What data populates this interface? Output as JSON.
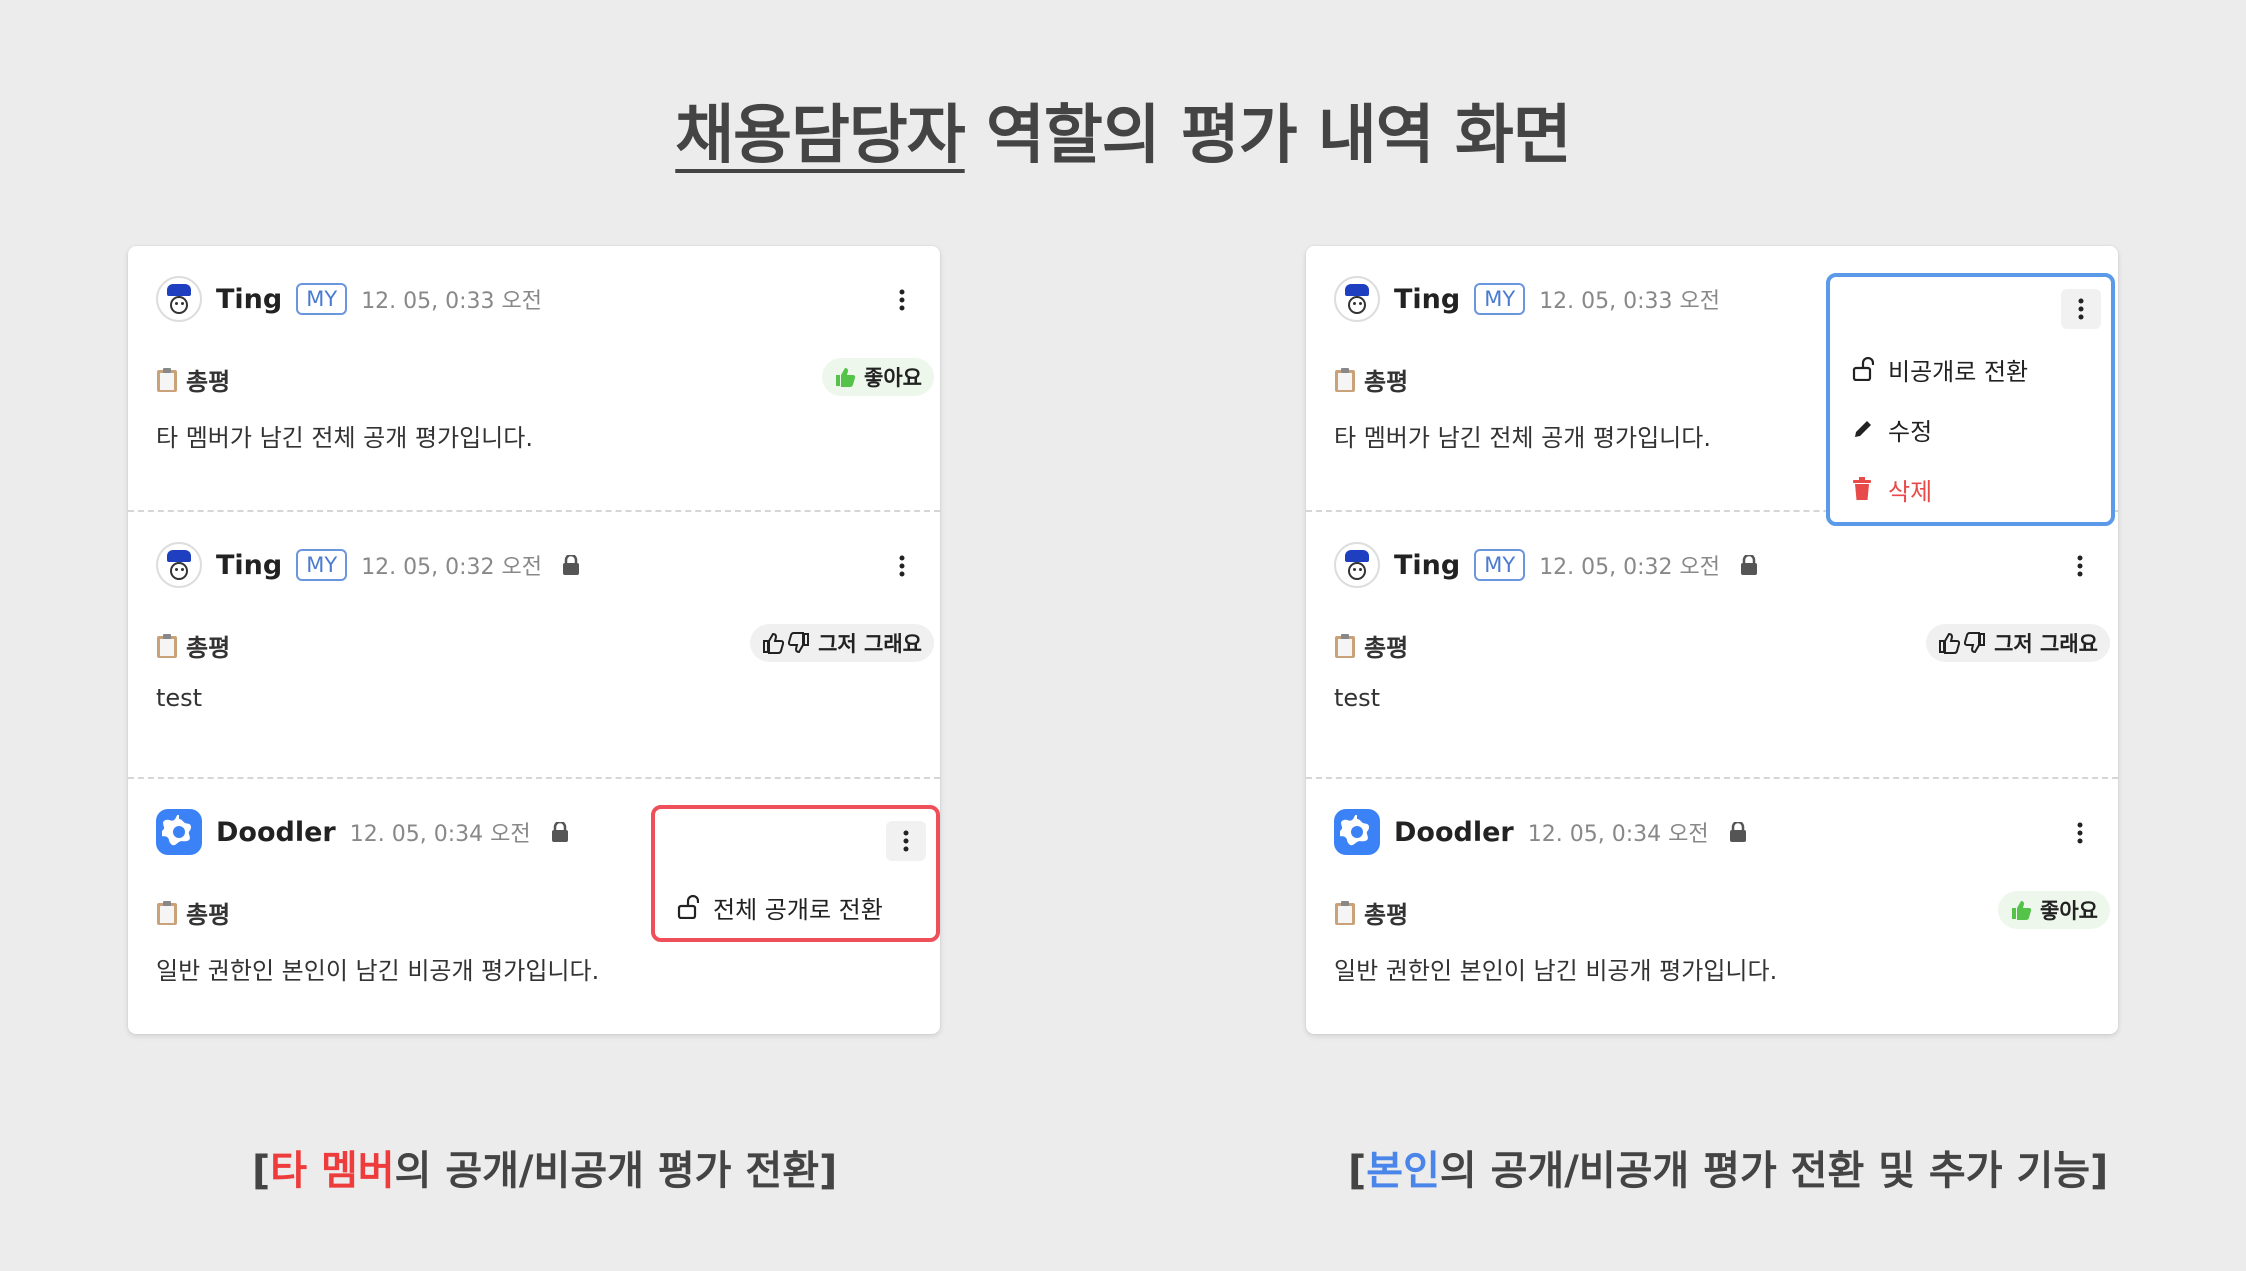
{
  "page": {
    "title_underlined": "채용담당자",
    "title_rest": " 역할의 평가 내역 화면"
  },
  "left": {
    "cards": [
      {
        "name": "Ting",
        "badge": "MY",
        "time": "12. 05, 0:33 오전",
        "locked": false,
        "section": "총평",
        "pill": "좋아요",
        "body": "타 멤버가 남긴 전체 공개 평가입니다."
      },
      {
        "name": "Ting",
        "badge": "MY",
        "time": "12. 05, 0:32 오전",
        "locked": true,
        "section": "총평",
        "pill": "그저 그래요",
        "body": "test"
      },
      {
        "name": "Doodler",
        "time": "12. 05, 0:34 오전",
        "locked": true,
        "section": "총평",
        "body": "일반 권한인 본인이 남긴 비공개 평가입니다."
      }
    ],
    "menu": {
      "item_public": "전체 공개로 전환"
    },
    "caption": {
      "open": "[",
      "highlight": "타 멤버",
      "rest": "의 공개/비공개 평가 전환]"
    }
  },
  "right": {
    "cards": [
      {
        "name": "Ting",
        "badge": "MY",
        "time": "12. 05, 0:33 오전",
        "locked": false,
        "section": "총평",
        "body": "타 멤버가 남긴 전체 공개 평가입니다."
      },
      {
        "name": "Ting",
        "badge": "MY",
        "time": "12. 05, 0:32 오전",
        "locked": true,
        "section": "총평",
        "pill": "그저 그래요",
        "body": "test"
      },
      {
        "name": "Doodler",
        "time": "12. 05, 0:34 오전",
        "locked": true,
        "section": "총평",
        "pill": "좋아요",
        "body": "일반 권한인 본인이 남긴 비공개 평가입니다."
      }
    ],
    "menu": {
      "item_private": "비공개로 전환",
      "item_edit": "수정",
      "item_delete": "삭제"
    },
    "caption": {
      "open": "[",
      "highlight": "본인",
      "rest": "의 공개/비공개 평가 전환 및 추가 기능]"
    }
  },
  "colors": {
    "accent_red": "#ee3b3b",
    "accent_blue": "#4a86ea",
    "good_green": "#55c24a"
  }
}
